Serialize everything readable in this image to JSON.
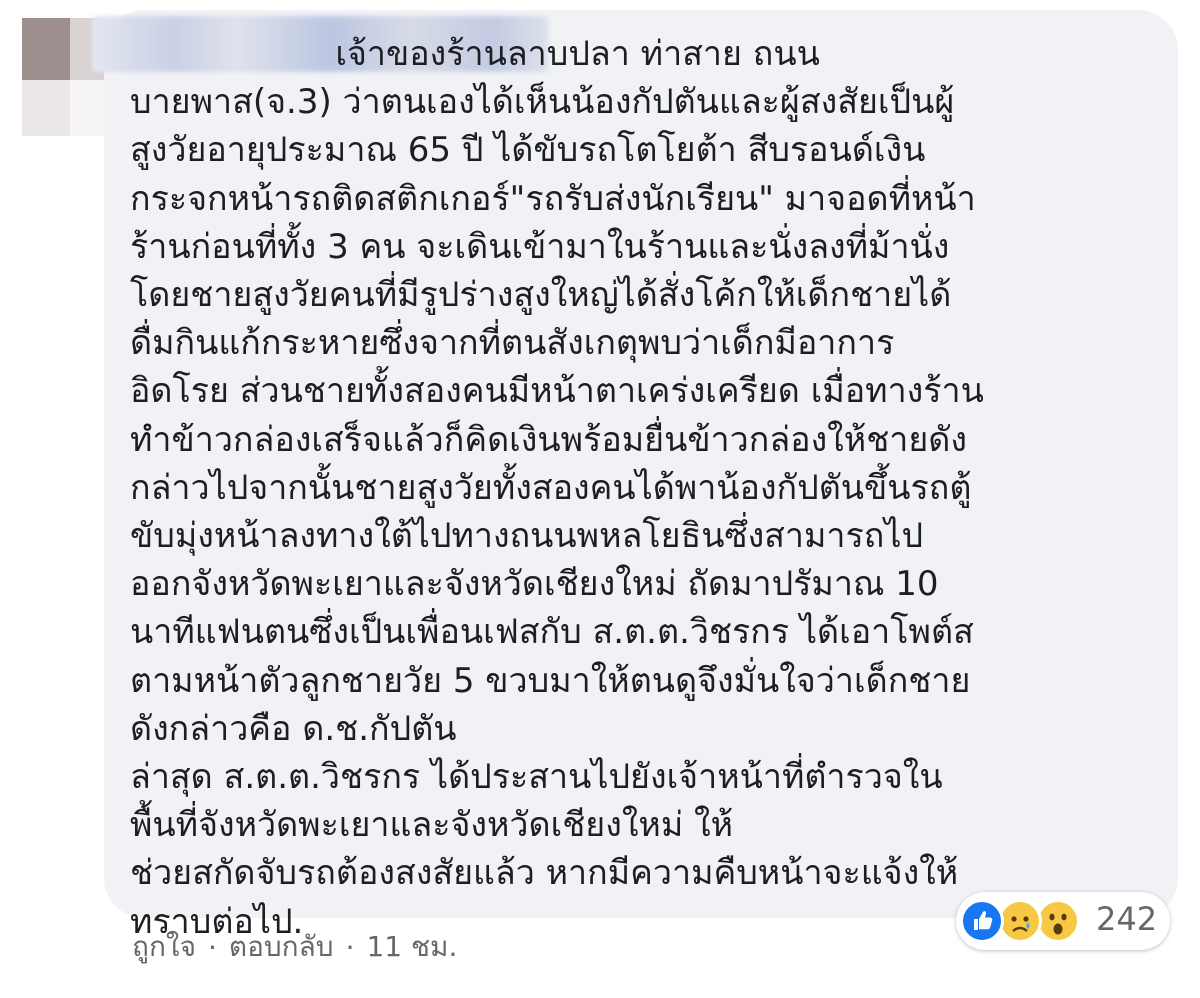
{
  "comment": {
    "text_lines": [
      "                   เจ้าของร้านลาบปลา ท่าสาย ถนน",
      "บายพาส(จ.3) ว่าตนเองได้เห็นน้องกัปตันและผู้สงสัยเป็นผู้",
      "สูงวัยอายุประมาณ 65 ปี ได้ขับรถโตโยต้า สีบรอนด์เงิน",
      "กระจกหน้ารถติดสติกเกอร์\"รถรับส่งนักเรียน\" มาจอดที่หน้า",
      "ร้านก่อนที่ทั้ง 3 คน จะเดินเข้ามาในร้านและนั่งลงที่ม้านั่ง",
      "โดยชายสูงวัยคนที่มีรูปร่างสูงใหญ่ได้สั่งโค้กให้เด็กชายได้",
      "ดื่มกินแก้กระหายซึ่งจากที่ตนสังเกตุพบว่าเด็กมีอาการ",
      "อิดโรย ส่วนชายทั้งสองคนมีหน้าตาเคร่งเครียด เมื่อทางร้าน",
      "ทำข้าวกล่องเสร็จแล้วก็คิดเงินพร้อมยื่นข้าวกล่องให้ชายดัง",
      "กล่าวไปจากนั้นชายสูงวัยทั้งสองคนได้พาน้องกัปตันขึ้นรถตู้",
      "ขับมุ่งหน้าลงทางใต้ไปทางถนนพหลโยธินซึ่งสามารถไป",
      "ออกจังหวัดพะเยาและจังหวัดเชียงใหม่ ถัดมาปรัมาณ 10",
      "นาทีแฟนตนซึ่งเป็นเพื่อนเฟสกับ ส.ต.ต.วิชรกร ได้เอาโพต์ส",
      "ตามหน้าตัวลูกชายวัย 5 ขวบมาให้ตนดูจึงมั่นใจว่าเด็กชาย",
      "ดังกล่าวคือ ด.ช.กัปตัน",
      "ล่าสุด ส.ต.ต.วิชรกร ได้ประสานไปยังเจ้าหน้าที่ตำรวจใน",
      "พื้นที่จังหวัดพะเยาและจังหวัดเชียงใหม่ ให้",
      "ช่วยสกัดจับรถต้องสงสัยแล้ว หากมีความคืบหน้าจะแจ้งให้",
      "ทราบต่อไป."
    ]
  },
  "reactions": {
    "icons": [
      "like-icon",
      "sad-icon",
      "wow-icon"
    ],
    "count": "242"
  },
  "actions": {
    "like_label": "ถูกใจ",
    "separator": "·",
    "reply_label": "ตอบกลับ",
    "time_label": "11 ชม."
  },
  "colors": {
    "bubble_bg": "#f0f2f5",
    "text": "#1c1e21",
    "meta_text": "#65676b",
    "like_blue": "#1877f2",
    "emoji_yellow": "#f7c843"
  }
}
